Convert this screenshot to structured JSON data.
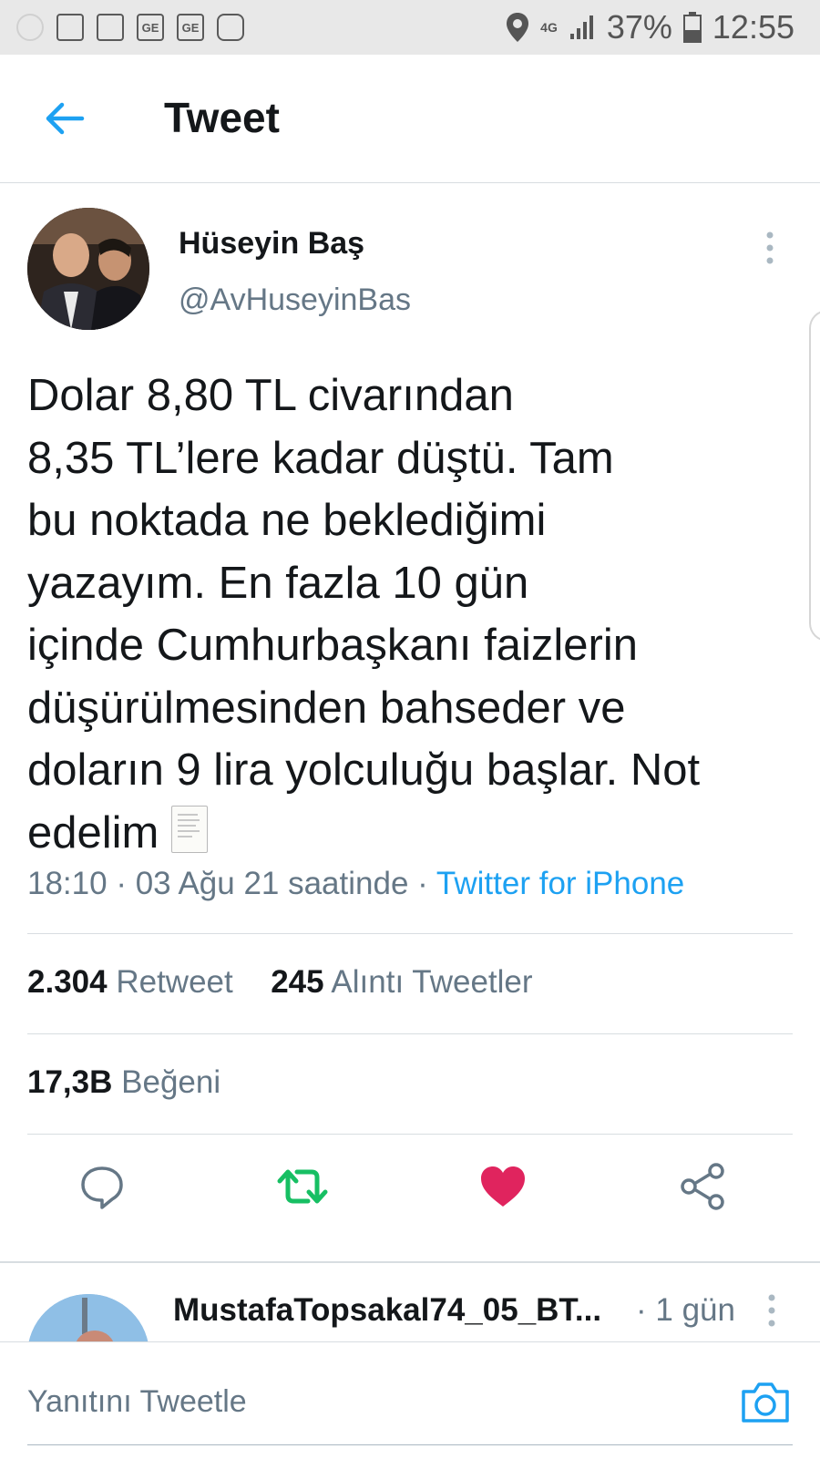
{
  "status_bar": {
    "network": "4G",
    "battery": "37%",
    "time": "12:55",
    "left_icons": [
      "circle-icon",
      "laptop-icon",
      "image-icon",
      "ge-icon",
      "ge-icon",
      "instagram-icon"
    ],
    "ge_label": "GE"
  },
  "header": {
    "title": "Tweet"
  },
  "tweet": {
    "author_name": "Hüseyin Baş",
    "author_handle": "@AvHuseyinBas",
    "text": "Dolar 8,80 TL civarından\n8,35  TL’lere kadar düştü. Tam\nbu noktada ne beklediğimi\nyazayım. En fazla 10 gün\niçinde Cumhurbaşkanı faizlerin\ndüşürülmesinden bahseder ve\ndoların 9 lira yolculuğu başlar. Not\nedelim",
    "time": "18:10",
    "date": "03 Ağu 21 saatinde",
    "source": "Twitter for iPhone",
    "separator": "·"
  },
  "stats": {
    "retweets": "2.304",
    "retweets_label": "Retweet",
    "quotes": "245",
    "quotes_label": "Alıntı Tweetler",
    "likes": "17,3B",
    "likes_label": "Beğeni"
  },
  "actions": [
    "reply-icon",
    "retweet-icon",
    "like-icon",
    "share-icon"
  ],
  "colors": {
    "accent": "#1da1f2",
    "retweet": "#17bf63",
    "like": "#e0245e",
    "muted": "#657786"
  },
  "reply": {
    "author_name": "MustafaTopsakal74_05_BT...",
    "time": "· 1 gün"
  },
  "compose": {
    "placeholder": "Yanıtını Tweetle"
  }
}
